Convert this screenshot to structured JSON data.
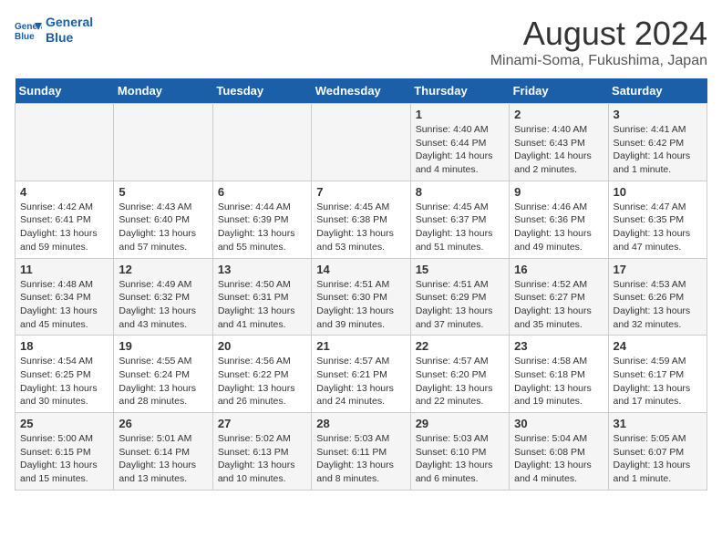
{
  "logo": {
    "line1": "General",
    "line2": "Blue"
  },
  "title": "August 2024",
  "subtitle": "Minami-Soma, Fukushima, Japan",
  "days_of_week": [
    "Sunday",
    "Monday",
    "Tuesday",
    "Wednesday",
    "Thursday",
    "Friday",
    "Saturday"
  ],
  "weeks": [
    [
      {
        "day": "",
        "info": ""
      },
      {
        "day": "",
        "info": ""
      },
      {
        "day": "",
        "info": ""
      },
      {
        "day": "",
        "info": ""
      },
      {
        "day": "1",
        "sunrise": "4:40 AM",
        "sunset": "6:44 PM",
        "daylight": "14 hours and 4 minutes."
      },
      {
        "day": "2",
        "sunrise": "4:40 AM",
        "sunset": "6:43 PM",
        "daylight": "14 hours and 2 minutes."
      },
      {
        "day": "3",
        "sunrise": "4:41 AM",
        "sunset": "6:42 PM",
        "daylight": "14 hours and 1 minute."
      }
    ],
    [
      {
        "day": "4",
        "sunrise": "4:42 AM",
        "sunset": "6:41 PM",
        "daylight": "13 hours and 59 minutes."
      },
      {
        "day": "5",
        "sunrise": "4:43 AM",
        "sunset": "6:40 PM",
        "daylight": "13 hours and 57 minutes."
      },
      {
        "day": "6",
        "sunrise": "4:44 AM",
        "sunset": "6:39 PM",
        "daylight": "13 hours and 55 minutes."
      },
      {
        "day": "7",
        "sunrise": "4:45 AM",
        "sunset": "6:38 PM",
        "daylight": "13 hours and 53 minutes."
      },
      {
        "day": "8",
        "sunrise": "4:45 AM",
        "sunset": "6:37 PM",
        "daylight": "13 hours and 51 minutes."
      },
      {
        "day": "9",
        "sunrise": "4:46 AM",
        "sunset": "6:36 PM",
        "daylight": "13 hours and 49 minutes."
      },
      {
        "day": "10",
        "sunrise": "4:47 AM",
        "sunset": "6:35 PM",
        "daylight": "13 hours and 47 minutes."
      }
    ],
    [
      {
        "day": "11",
        "sunrise": "4:48 AM",
        "sunset": "6:34 PM",
        "daylight": "13 hours and 45 minutes."
      },
      {
        "day": "12",
        "sunrise": "4:49 AM",
        "sunset": "6:32 PM",
        "daylight": "13 hours and 43 minutes."
      },
      {
        "day": "13",
        "sunrise": "4:50 AM",
        "sunset": "6:31 PM",
        "daylight": "13 hours and 41 minutes."
      },
      {
        "day": "14",
        "sunrise": "4:51 AM",
        "sunset": "6:30 PM",
        "daylight": "13 hours and 39 minutes."
      },
      {
        "day": "15",
        "sunrise": "4:51 AM",
        "sunset": "6:29 PM",
        "daylight": "13 hours and 37 minutes."
      },
      {
        "day": "16",
        "sunrise": "4:52 AM",
        "sunset": "6:27 PM",
        "daylight": "13 hours and 35 minutes."
      },
      {
        "day": "17",
        "sunrise": "4:53 AM",
        "sunset": "6:26 PM",
        "daylight": "13 hours and 32 minutes."
      }
    ],
    [
      {
        "day": "18",
        "sunrise": "4:54 AM",
        "sunset": "6:25 PM",
        "daylight": "13 hours and 30 minutes."
      },
      {
        "day": "19",
        "sunrise": "4:55 AM",
        "sunset": "6:24 PM",
        "daylight": "13 hours and 28 minutes."
      },
      {
        "day": "20",
        "sunrise": "4:56 AM",
        "sunset": "6:22 PM",
        "daylight": "13 hours and 26 minutes."
      },
      {
        "day": "21",
        "sunrise": "4:57 AM",
        "sunset": "6:21 PM",
        "daylight": "13 hours and 24 minutes."
      },
      {
        "day": "22",
        "sunrise": "4:57 AM",
        "sunset": "6:20 PM",
        "daylight": "13 hours and 22 minutes."
      },
      {
        "day": "23",
        "sunrise": "4:58 AM",
        "sunset": "6:18 PM",
        "daylight": "13 hours and 19 minutes."
      },
      {
        "day": "24",
        "sunrise": "4:59 AM",
        "sunset": "6:17 PM",
        "daylight": "13 hours and 17 minutes."
      }
    ],
    [
      {
        "day": "25",
        "sunrise": "5:00 AM",
        "sunset": "6:15 PM",
        "daylight": "13 hours and 15 minutes."
      },
      {
        "day": "26",
        "sunrise": "5:01 AM",
        "sunset": "6:14 PM",
        "daylight": "13 hours and 13 minutes."
      },
      {
        "day": "27",
        "sunrise": "5:02 AM",
        "sunset": "6:13 PM",
        "daylight": "13 hours and 10 minutes."
      },
      {
        "day": "28",
        "sunrise": "5:03 AM",
        "sunset": "6:11 PM",
        "daylight": "13 hours and 8 minutes."
      },
      {
        "day": "29",
        "sunrise": "5:03 AM",
        "sunset": "6:10 PM",
        "daylight": "13 hours and 6 minutes."
      },
      {
        "day": "30",
        "sunrise": "5:04 AM",
        "sunset": "6:08 PM",
        "daylight": "13 hours and 4 minutes."
      },
      {
        "day": "31",
        "sunrise": "5:05 AM",
        "sunset": "6:07 PM",
        "daylight": "13 hours and 1 minute."
      }
    ]
  ],
  "labels": {
    "sunrise_prefix": "Sunrise: ",
    "sunset_prefix": "Sunset: ",
    "daylight_prefix": "Daylight: "
  }
}
